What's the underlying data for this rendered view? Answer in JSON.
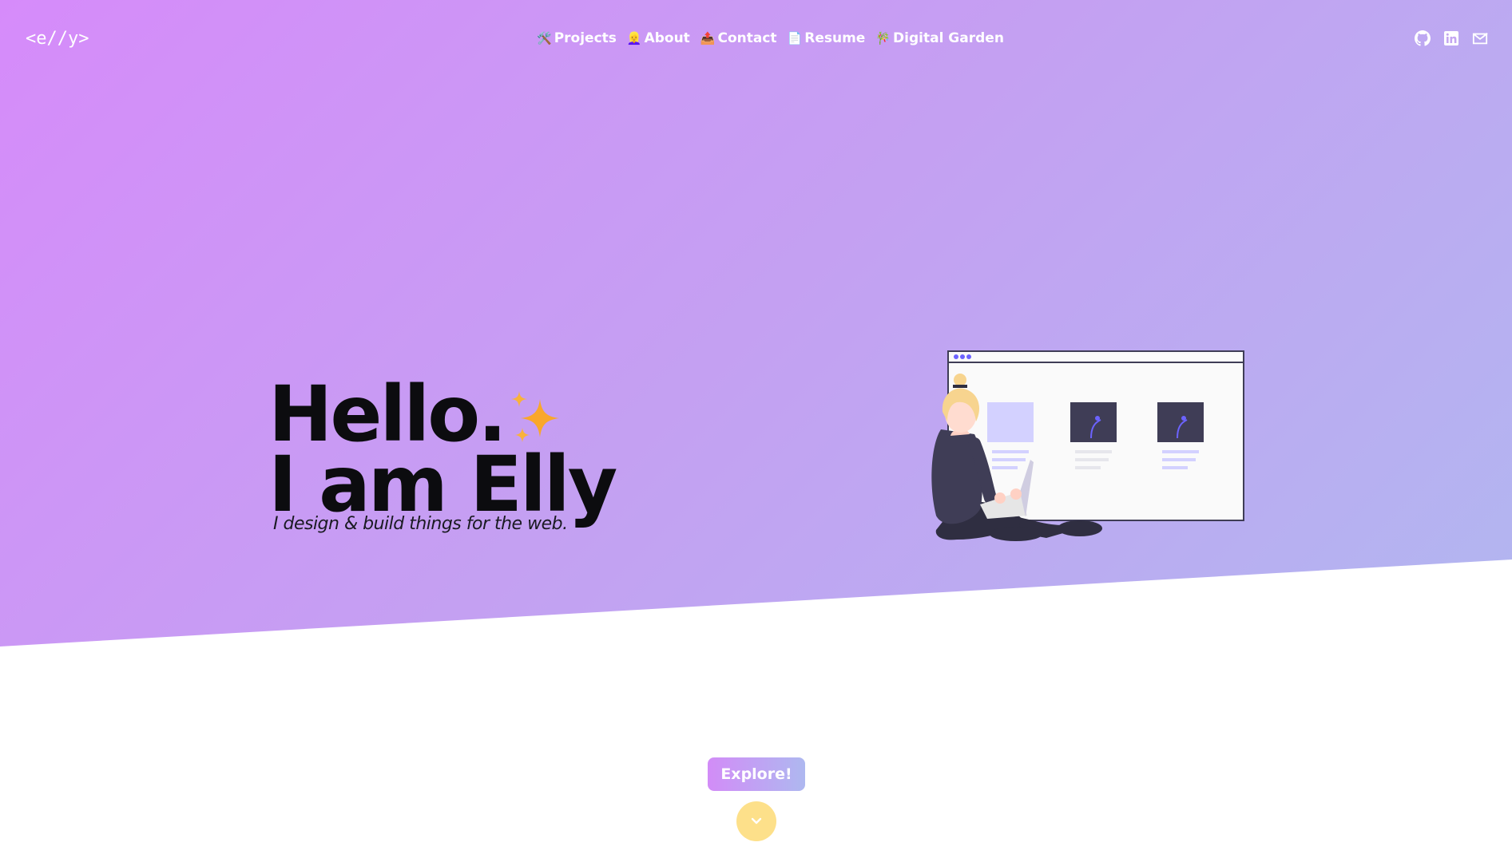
{
  "brand": {
    "logo_text": "<e//y>"
  },
  "nav": {
    "items": [
      {
        "emoji": "🛠️",
        "label": "Projects"
      },
      {
        "emoji": "👱‍♀️",
        "label": "About"
      },
      {
        "emoji": "📤",
        "label": "Contact"
      },
      {
        "emoji": "📄",
        "label": "Resume"
      },
      {
        "emoji": "🎋",
        "label": "Digital Garden"
      }
    ],
    "social": [
      "github-icon",
      "linkedin-icon",
      "mail-icon"
    ]
  },
  "hero": {
    "line1": "Hello.",
    "line2": "I am Elly",
    "subtitle": "I design & build things for the web."
  },
  "cta": {
    "label": "Explore!"
  },
  "colors": {
    "gradient_start": "#d68bfa",
    "gradient_end": "#aebbf0",
    "sparkle": "#f9a72b",
    "scroll_button": "#fde08a",
    "illustration_accent": "#6c63ff",
    "illustration_dark": "#3f3d56"
  }
}
